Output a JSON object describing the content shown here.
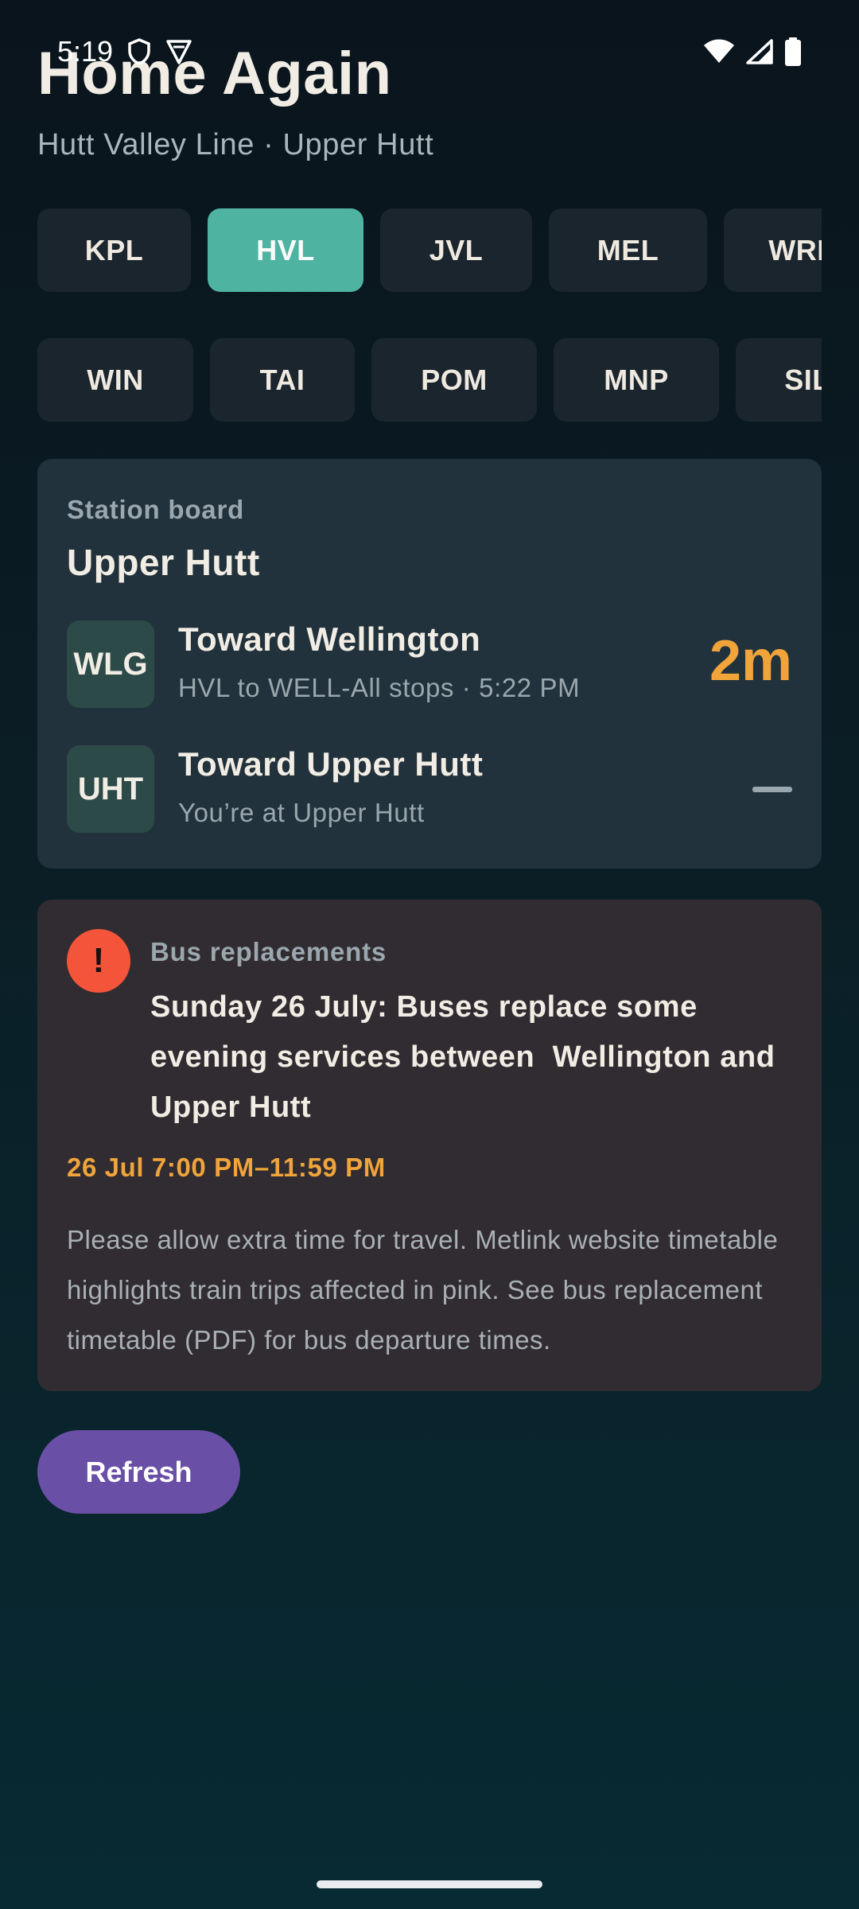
{
  "status_bar": {
    "time": "5:19",
    "icons": [
      "shield-icon",
      "navigation-icon",
      "wifi-icon",
      "signal-icon",
      "battery-icon"
    ]
  },
  "header": {
    "title": "Home Again",
    "subtitle": "Hutt Valley Line · Upper Hutt"
  },
  "line_chips": [
    {
      "label": "KPL",
      "active": false
    },
    {
      "label": "HVL",
      "active": true
    },
    {
      "label": "JVL",
      "active": false
    },
    {
      "label": "MEL",
      "active": false
    },
    {
      "label": "WRL",
      "active": false
    }
  ],
  "station_chips": [
    {
      "label": "WIN"
    },
    {
      "label": "TAI"
    },
    {
      "label": "POM"
    },
    {
      "label": "MNP"
    },
    {
      "label": "SIL"
    }
  ],
  "board": {
    "label": "Station board",
    "station": "Upper Hutt",
    "departures": [
      {
        "code": "WLG",
        "title": "Toward Wellington",
        "subtitle": "HVL to WELL-All stops · 5:22 PM",
        "time": "2m"
      },
      {
        "code": "UHT",
        "title": "Toward Upper Hutt",
        "subtitle": "You’re at Upper Hutt",
        "time": ""
      }
    ]
  },
  "alert": {
    "icon": "!",
    "category": "Bus replacements",
    "headline": "Sunday 26 July: Buses replace some evening services between  Wellington and Upper Hutt",
    "when": "26 Jul 7:00 PM–11:59 PM",
    "body": "Please allow extra time for travel. Metlink website timetable highlights train trips affected in pink. See bus replacement timetable (PDF) for bus departure times."
  },
  "actions": {
    "refresh_label": "Refresh"
  },
  "colors": {
    "accent_active_chip": "#4fb3a2",
    "countdown": "#f0a43a",
    "alert_icon": "#f4553a",
    "refresh_button": "#6a4fa6"
  }
}
